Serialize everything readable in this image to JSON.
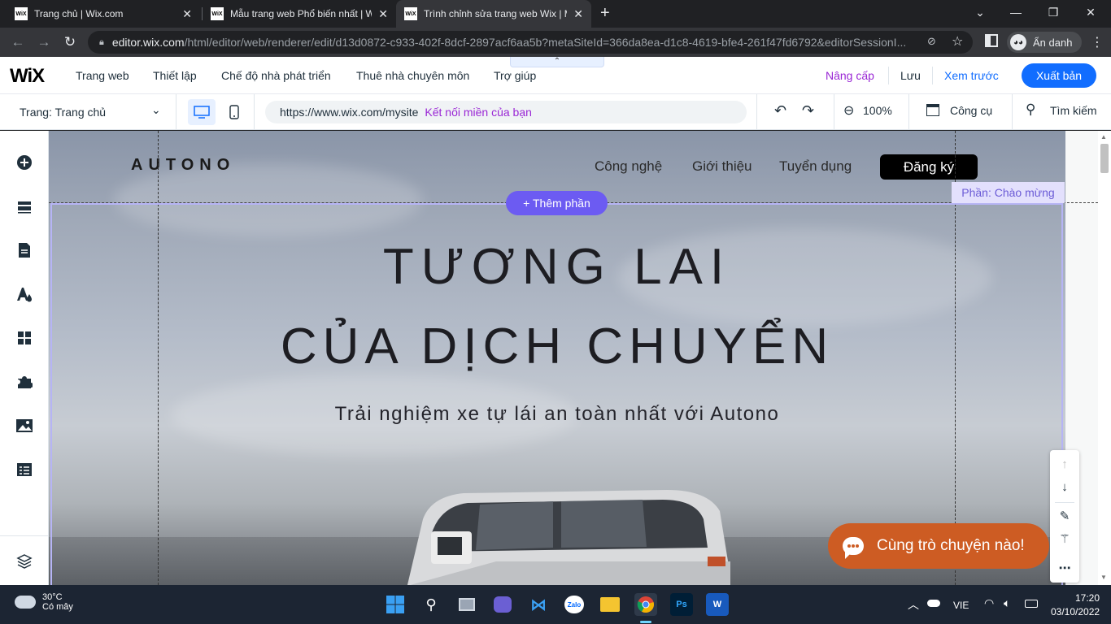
{
  "browser": {
    "tabs": [
      {
        "favicon": "WiX",
        "title": "Trang chủ | Wix.com",
        "active": false
      },
      {
        "favicon": "WiX",
        "title": "Mẫu trang web Phổ biến nhất | W",
        "active": false
      },
      {
        "favicon": "WiX",
        "title": "Trình chỉnh sửa trang web Wix | M",
        "active": true
      }
    ],
    "new_tab": "+",
    "url_host": "editor.wix.com",
    "url_path": "/html/editor/web/renderer/edit/d13d0872-c933-402f-8dcf-2897acf6aa5b?metaSiteId=366da8ea-d1c8-4619-bfe4-261f47fd6792&editorSessionI...",
    "incognito_label": "Ẩn danh"
  },
  "wix_top": {
    "logo": "WiX",
    "menu": [
      "Trang web",
      "Thiết lập",
      "Chế độ nhà phát triển",
      "Thuê nhà chuyên môn",
      "Trợ giúp"
    ],
    "collapse": "⌃",
    "upgrade": "Nâng cấp",
    "save": "Lưu",
    "preview": "Xem trước",
    "publish": "Xuất bản"
  },
  "wix_tools": {
    "page_selector": "Trang: Trang chủ",
    "site_url": "https://www.wix.com/mysite",
    "connect_domain": "Kết nối miền của bạn",
    "zoom": "100%",
    "tools": "Công cụ",
    "search": "Tìm kiếm"
  },
  "site": {
    "logo": "AUTONO",
    "nav": [
      "Công nghệ",
      "Giới thiệu",
      "Tuyển dụng"
    ],
    "signup": "Đăng ký",
    "add_section": "+ Thêm phần",
    "section_tag": "Phần: Chào mừng",
    "hero_line1": "TƯƠNG LAI",
    "hero_line2": "CỦA DỊCH CHUYỂN",
    "hero_sub": "Trải nghiệm xe tự lái an toàn nhất với Autono"
  },
  "chat": {
    "label": "Cùng trò chuyện nào!"
  },
  "taskbar": {
    "temp": "30°C",
    "weather": "Có mây",
    "lang": "VIE",
    "time": "17:20",
    "date": "03/10/2022"
  },
  "colors": {
    "wix_blue": "#116dff",
    "upgrade_purple": "#9a27d5",
    "section_purple": "#6c5bf2",
    "chat_orange": "#cd5c23"
  }
}
